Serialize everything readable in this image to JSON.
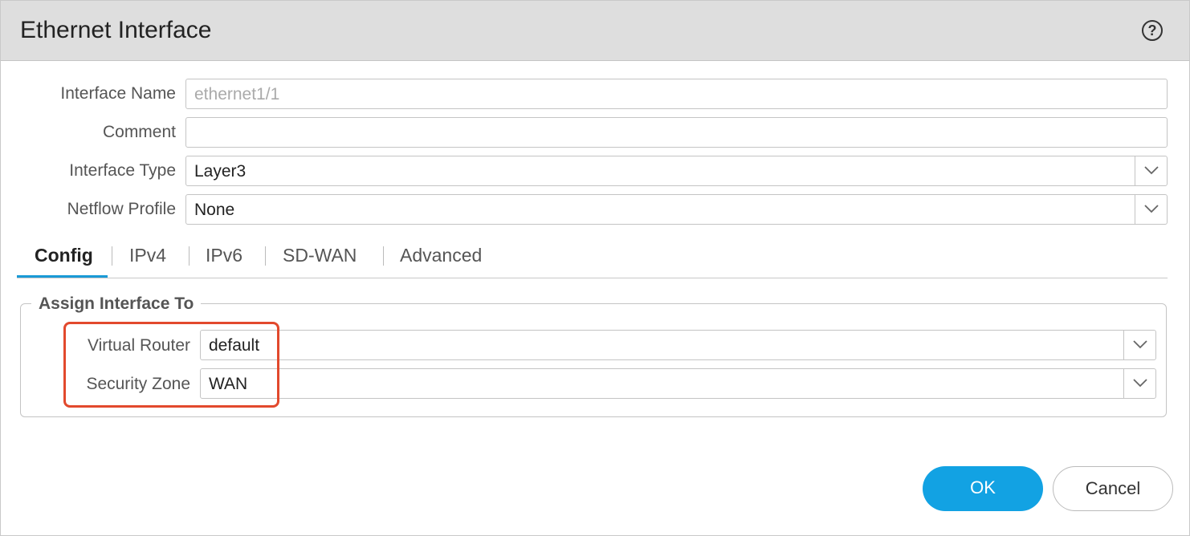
{
  "dialog": {
    "title": "Ethernet Interface",
    "help_glyph": "?"
  },
  "form": {
    "interface_name": {
      "label": "Interface Name",
      "value": "ethernet1/1"
    },
    "comment": {
      "label": "Comment",
      "value": ""
    },
    "interface_type": {
      "label": "Interface Type",
      "value": "Layer3"
    },
    "netflow_profile": {
      "label": "Netflow Profile",
      "value": "None"
    }
  },
  "tabs": [
    {
      "label": "Config",
      "active": true
    },
    {
      "label": "IPv4",
      "active": false
    },
    {
      "label": "IPv6",
      "active": false
    },
    {
      "label": "SD-WAN",
      "active": false
    },
    {
      "label": "Advanced",
      "active": false
    }
  ],
  "assign": {
    "legend": "Assign Interface To",
    "virtual_router": {
      "label": "Virtual Router",
      "value": "default"
    },
    "security_zone": {
      "label": "Security Zone",
      "value": "WAN"
    }
  },
  "buttons": {
    "ok": "OK",
    "cancel": "Cancel"
  },
  "colors": {
    "accent": "#12a2e3",
    "highlight": "#e2492d",
    "tab_underline": "#1a9ad6",
    "titlebar": "#dedede"
  },
  "icons": {
    "help": "help-icon",
    "dropdown": "chevron-down-icon"
  }
}
